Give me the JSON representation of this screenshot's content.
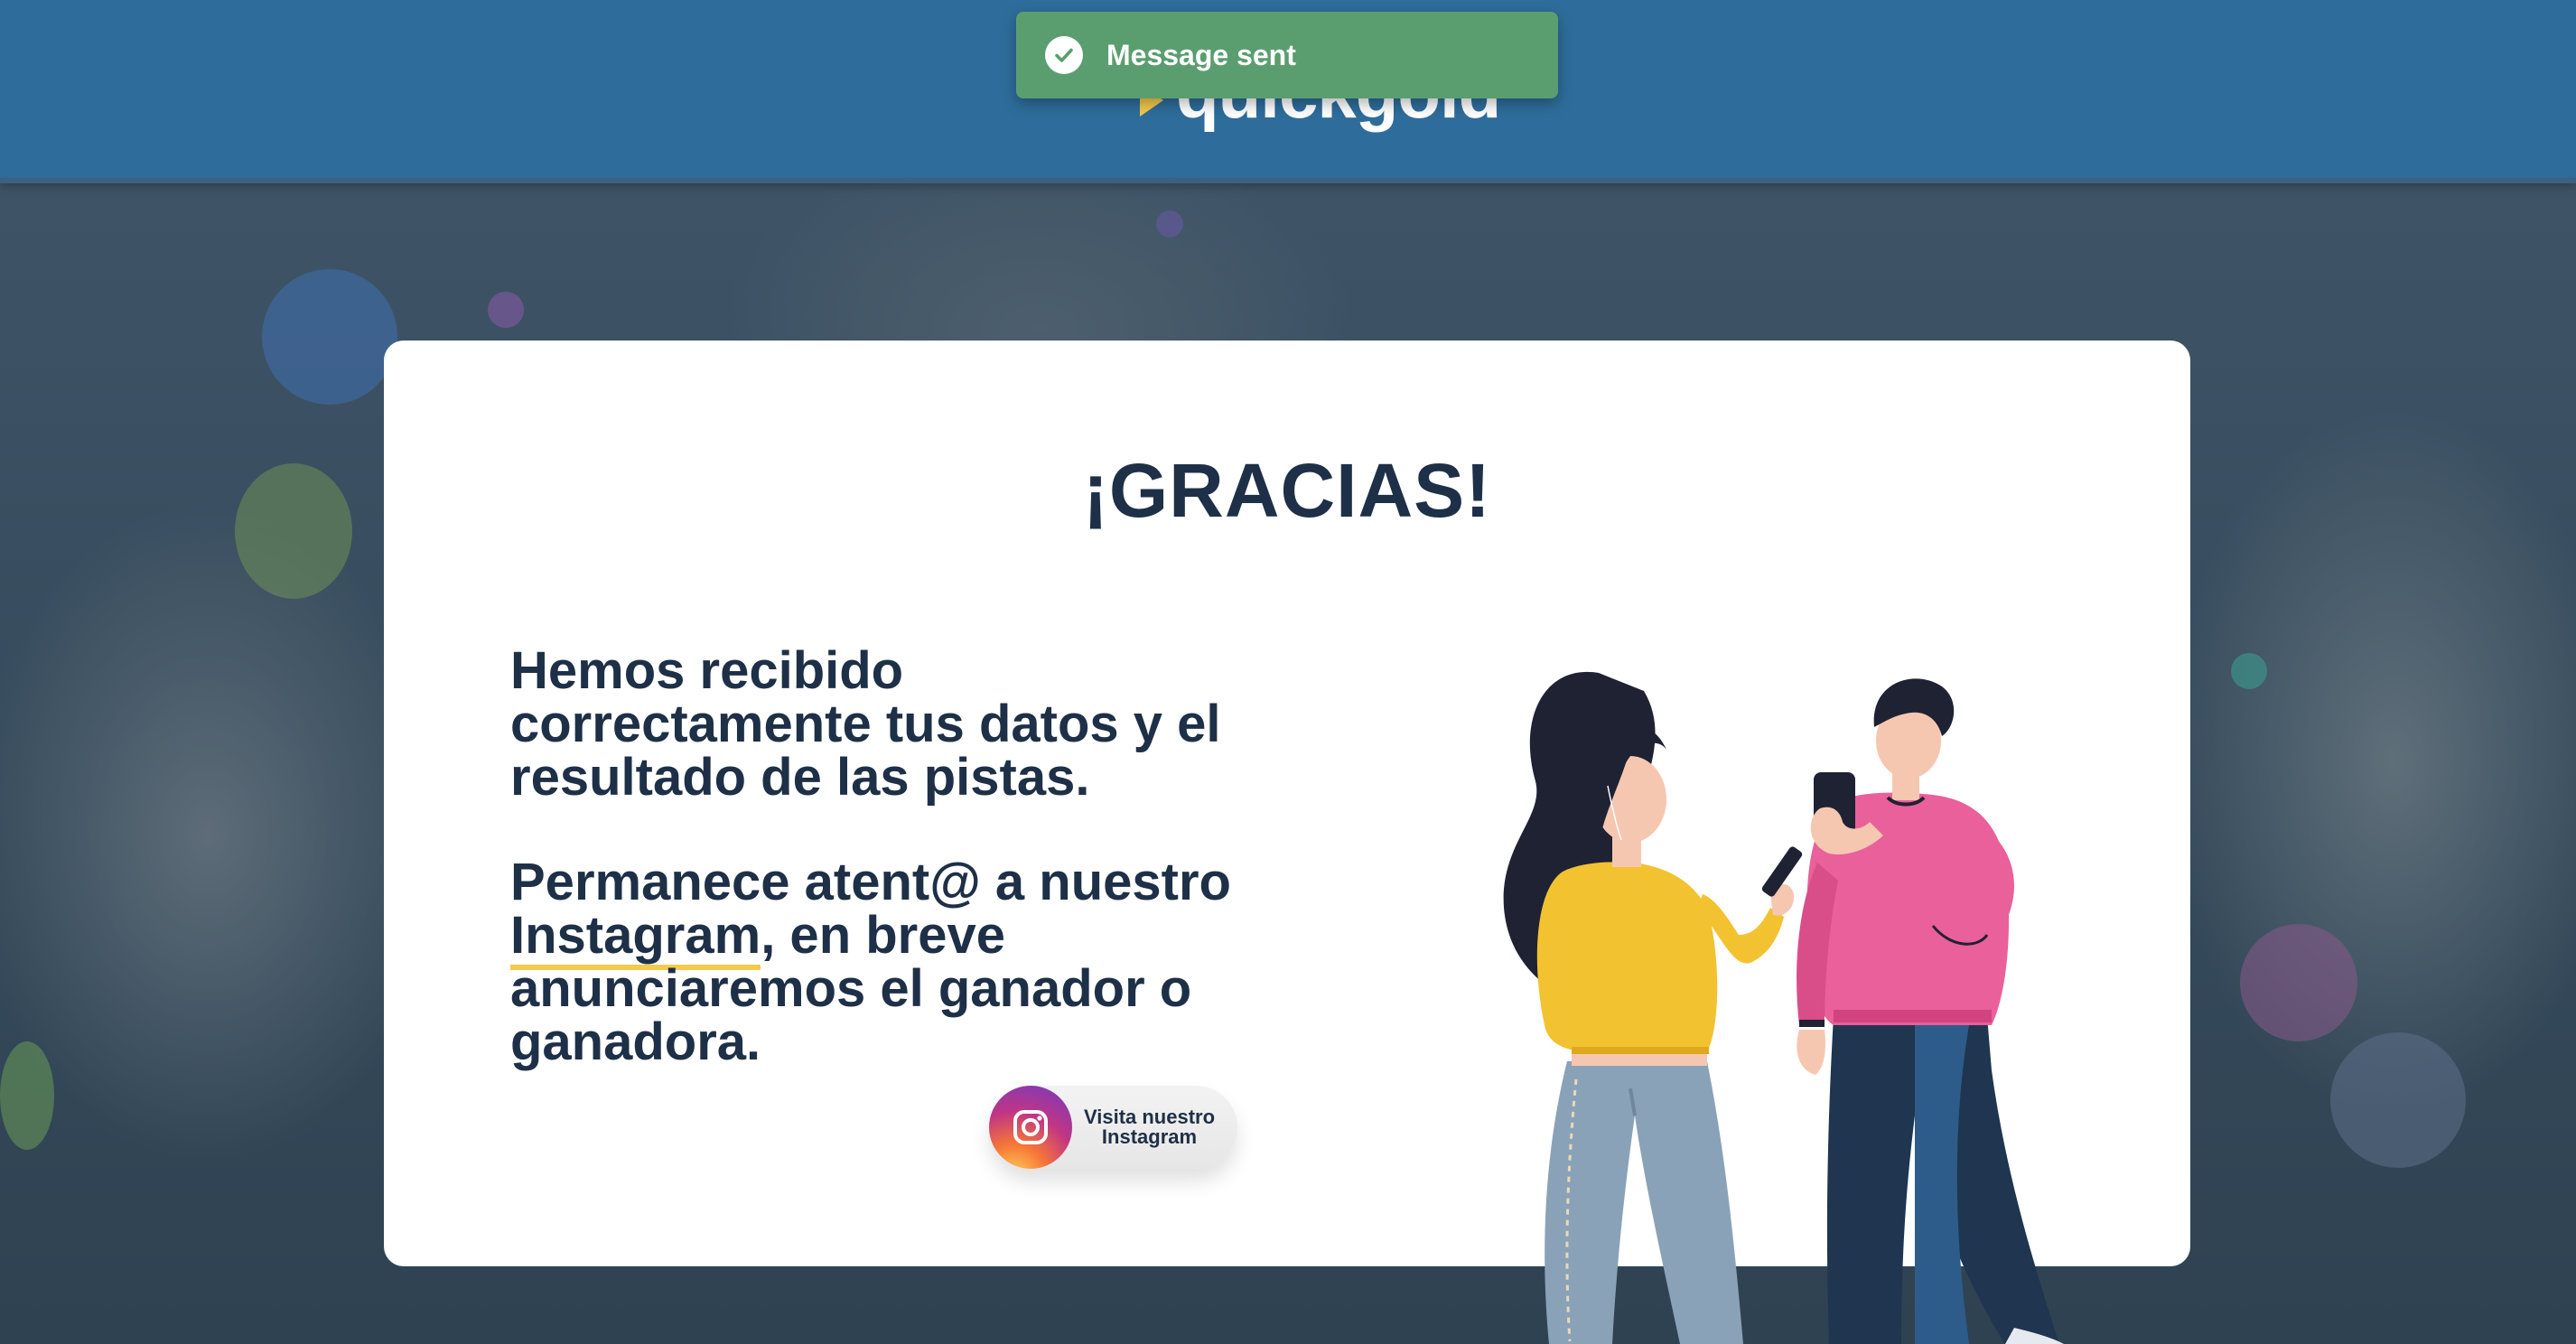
{
  "header": {
    "logo_text": "quickgold"
  },
  "toast": {
    "message": "Message sent",
    "icon": "check-circle-icon",
    "color": "#5a9e6f"
  },
  "card": {
    "title": "¡GRACIAS!",
    "paragraph1": "Hemos recibido correctamente tus datos y el resultado de las pistas.",
    "paragraph2_before": "Permanece atent@ a nuestro ",
    "paragraph2_link": "Instagram",
    "paragraph2_after": ", en breve anunciaremos el ganador o ganadora.",
    "instagram_button": {
      "line1": "Visita nuestro",
      "line2": "Instagram",
      "icon": "instagram-icon"
    }
  },
  "colors": {
    "header_bg": "#2e6d9b",
    "text_dark": "#1e3047",
    "accent_yellow": "#f5c94a"
  }
}
